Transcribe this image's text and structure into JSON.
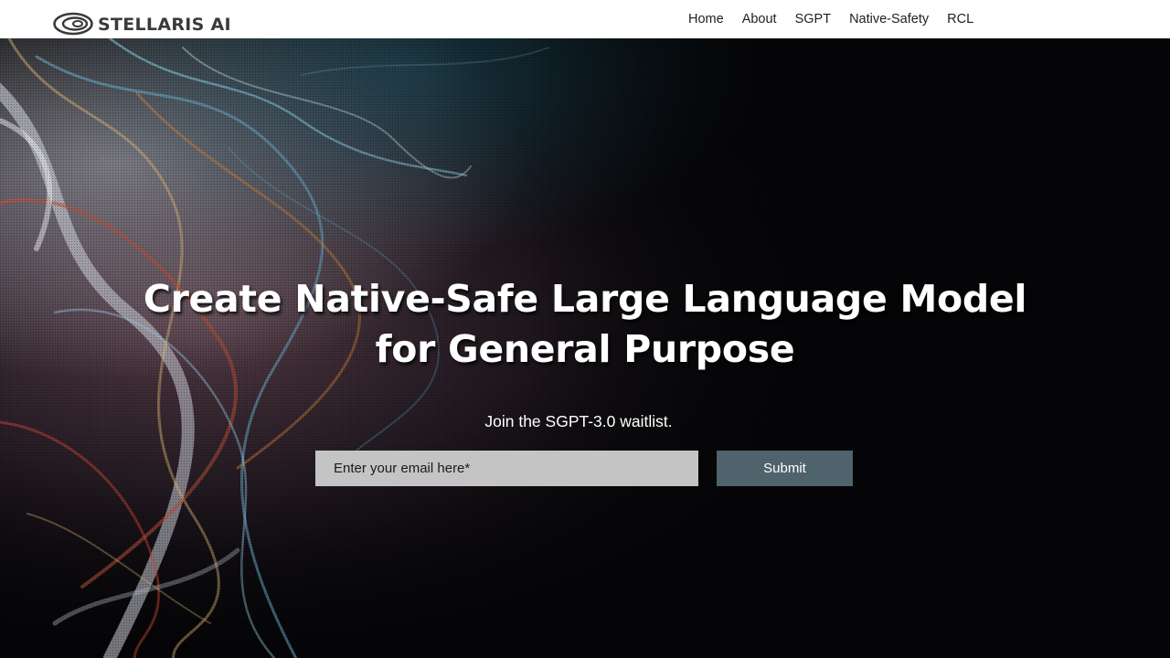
{
  "header": {
    "brand": "STELLARIS AI",
    "logo_icon": "stellaris-orbit-logo",
    "nav": [
      {
        "label": "Home",
        "name": "nav-home"
      },
      {
        "label": "About",
        "name": "nav-about"
      },
      {
        "label": "SGPT",
        "name": "nav-sgpt"
      },
      {
        "label": "Native-Safety",
        "name": "nav-native-safety"
      },
      {
        "label": "RCL",
        "name": "nav-rcl"
      }
    ]
  },
  "hero": {
    "title_line1": "Create Native-Safe Large Language Model",
    "title_line2": "for General Purpose",
    "subtitle": "Join the SGPT-3.0 waitlist.",
    "email_placeholder": "Enter your email here*",
    "submit_label": "Submit"
  },
  "colors": {
    "header_bg": "#ffffff",
    "hero_bg": "#050507",
    "input_bg": "#c4c4c4",
    "button_bg": "#4e636b",
    "text_light": "#ffffff",
    "text_dark": "#1f1f1f"
  }
}
